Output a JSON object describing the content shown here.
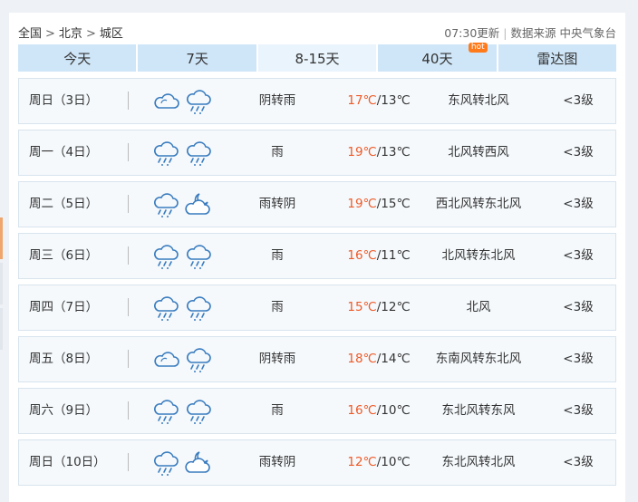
{
  "breadcrumb": {
    "root": "全国",
    "province": "北京",
    "district": "城区",
    "separator": ">"
  },
  "meta": {
    "update_time": "07:30更新",
    "source": "数据来源 中央气象台"
  },
  "tabs": [
    {
      "label": "今天",
      "active": false
    },
    {
      "label": "7天",
      "active": false
    },
    {
      "label": "8-15天",
      "active": true
    },
    {
      "label": "40天",
      "active": false,
      "badge": "hot"
    },
    {
      "label": "雷达图",
      "active": false
    }
  ],
  "forecast": [
    {
      "day": "周日（3日）",
      "icon1": "cloudy-icon",
      "icon2": "rain-icon",
      "condition": "阴转雨",
      "high": "17℃",
      "low": "/13℃",
      "wind": "东风转北风",
      "level": "<3级"
    },
    {
      "day": "周一（4日）",
      "icon1": "rain-icon",
      "icon2": "rain-icon",
      "condition": "雨",
      "high": "19℃",
      "low": "/13℃",
      "wind": "北风转西风",
      "level": "<3级"
    },
    {
      "day": "周二（5日）",
      "icon1": "rain-icon",
      "icon2": "cloudy-night-icon",
      "condition": "雨转阴",
      "high": "19℃",
      "low": "/15℃",
      "wind": "西北风转东北风",
      "level": "<3级"
    },
    {
      "day": "周三（6日）",
      "icon1": "rain-icon",
      "icon2": "rain-icon",
      "condition": "雨",
      "high": "16℃",
      "low": "/11℃",
      "wind": "北风转东北风",
      "level": "<3级"
    },
    {
      "day": "周四（7日）",
      "icon1": "rain-icon",
      "icon2": "rain-icon",
      "condition": "雨",
      "high": "15℃",
      "low": "/12℃",
      "wind": "北风",
      "level": "<3级"
    },
    {
      "day": "周五（8日）",
      "icon1": "cloudy-icon",
      "icon2": "rain-icon",
      "condition": "阴转雨",
      "high": "18℃",
      "low": "/14℃",
      "wind": "东南风转东北风",
      "level": "<3级"
    },
    {
      "day": "周六（9日）",
      "icon1": "rain-icon",
      "icon2": "rain-icon",
      "condition": "雨",
      "high": "16℃",
      "low": "/10℃",
      "wind": "东北风转东风",
      "level": "<3级"
    },
    {
      "day": "周日（10日）",
      "icon1": "rain-icon",
      "icon2": "cloudy-night-icon",
      "condition": "雨转阴",
      "high": "12℃",
      "low": "/10℃",
      "wind": "东北风转北风",
      "level": "<3级"
    }
  ]
}
